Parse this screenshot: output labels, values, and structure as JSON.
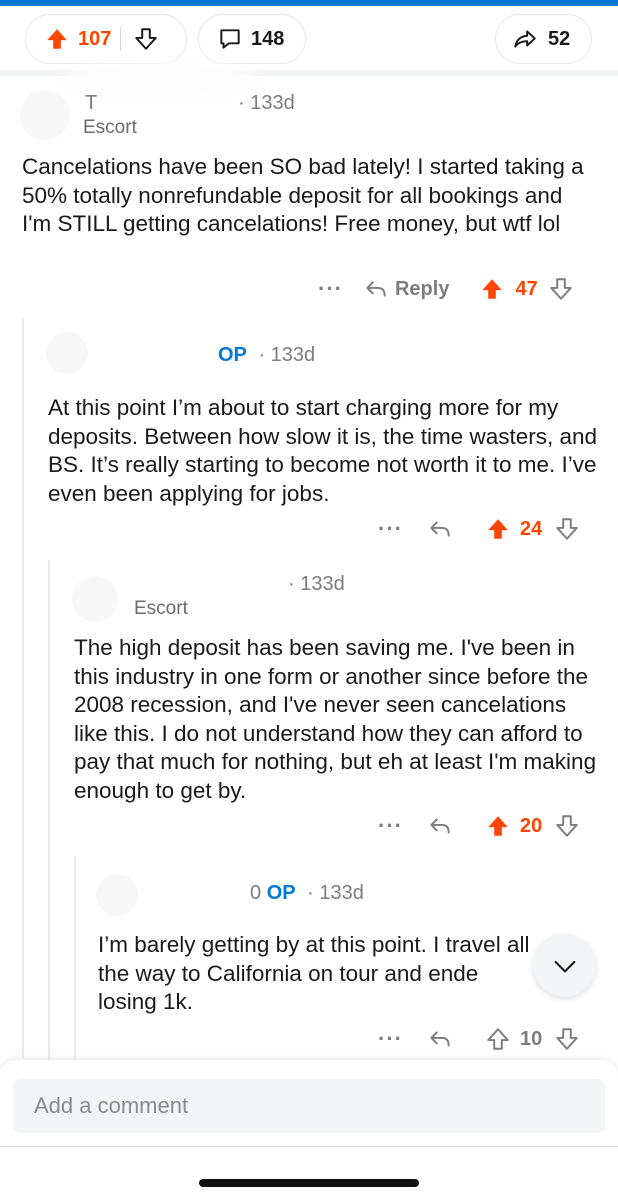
{
  "colors": {
    "upvote": "#ff4500",
    "op": "#0079d3",
    "accent_bar": "#0079d3",
    "meta": "#7c7c7c"
  },
  "post_actions": {
    "upvote_count": "107",
    "comment_count": "148",
    "share_count": "52",
    "icons": [
      "upvote-icon",
      "downvote-icon",
      "comment-icon",
      "share-icon"
    ]
  },
  "comments": [
    {
      "author_initial": "T",
      "age": "· 133d",
      "flair": "Escort",
      "body": "Cancelations have been SO bad lately! I started taking a 50% totally nonrefundable deposit for all bookings and I'm STILL getting cancelations! Free money, but wtf lol",
      "reply_label": "Reply",
      "score": "47",
      "upvoted": true
    },
    {
      "op_badge": "OP",
      "age": "· 133d",
      "body": "At this point I’m about to start charging more for my deposits. Between how slow it is, the time wasters, and BS. It’s really starting to become not worth it to me. I’ve even been applying for jobs.",
      "score": "24",
      "upvoted": true
    },
    {
      "age": "· 133d",
      "flair": "Escort",
      "body": "The high deposit has been saving me. I've been in this industry in one form or another since before the 2008 recession, and I've never seen cancelations like this. I do not understand how they can afford to pay that much for nothing, but eh at least I'm making enough to get by.",
      "score": "20",
      "upvoted": true
    },
    {
      "author_suffix": "0",
      "op_badge": "OP",
      "age": "· 133d",
      "body": "I’m barely getting by at this point. I travel all the way to California on tour and ende losing 1k.",
      "score": "10",
      "upvoted": false
    }
  ],
  "composer": {
    "placeholder": "Add a comment"
  }
}
